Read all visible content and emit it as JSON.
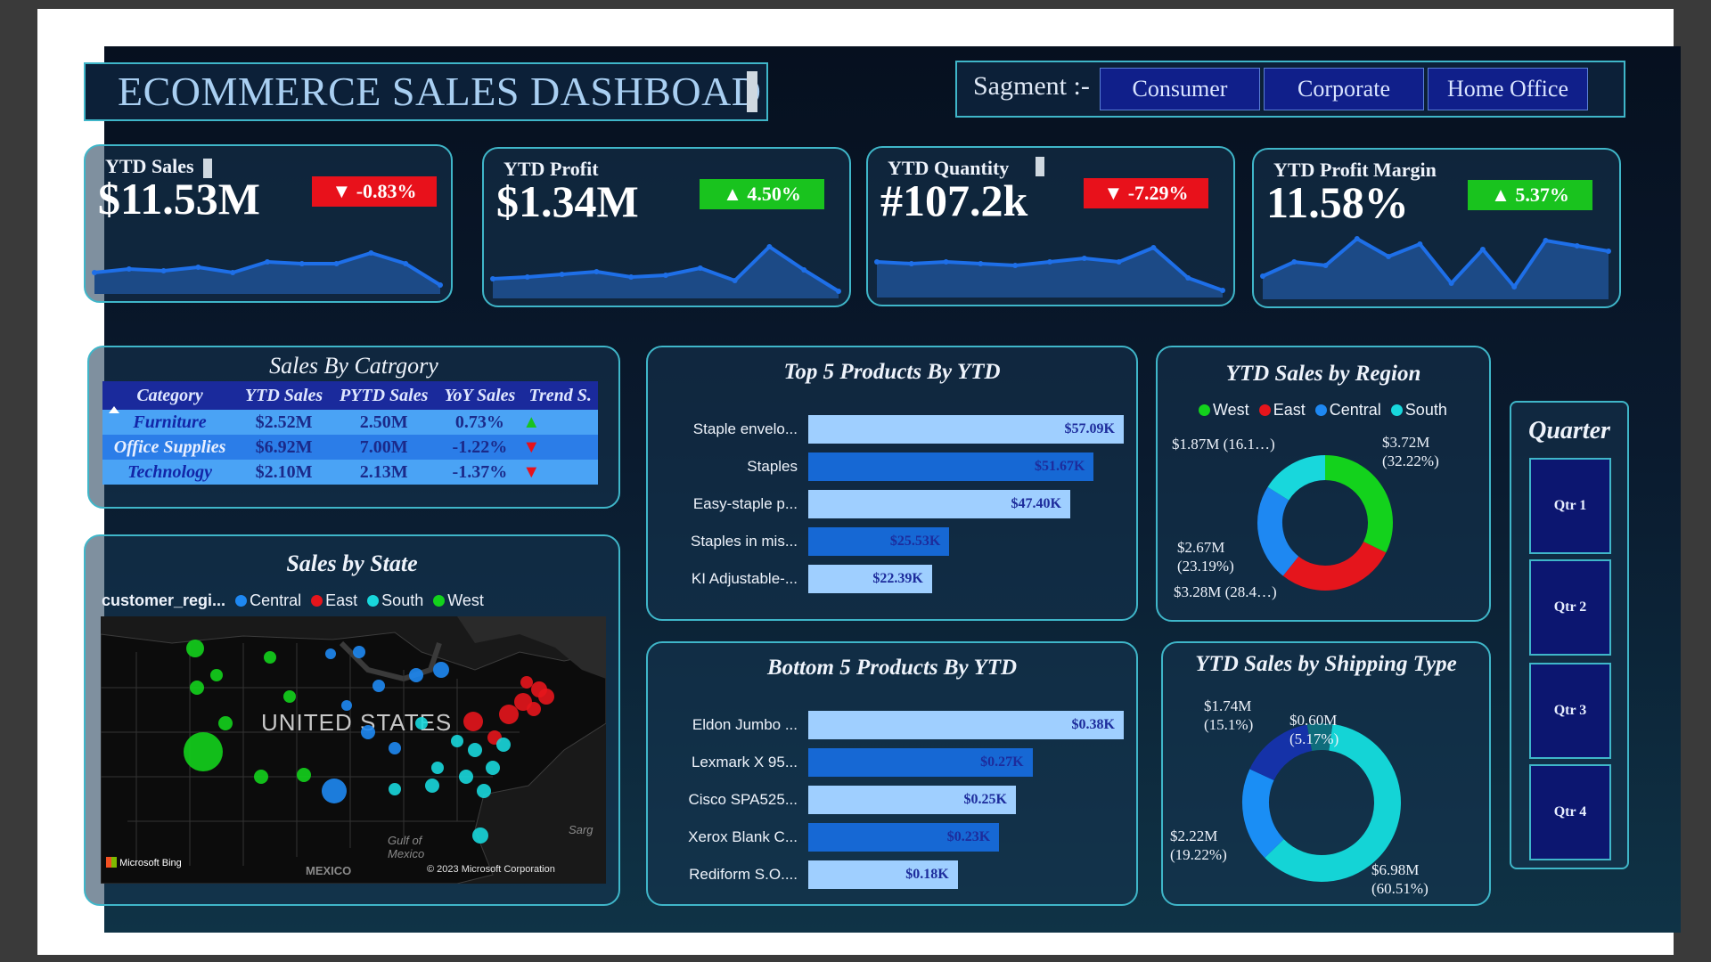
{
  "header": {
    "title": "ECOMMERCE SALES DASHBOAD"
  },
  "segment": {
    "label": "Sagment :-",
    "options": [
      "Consumer",
      "Corporate",
      "Home Office"
    ]
  },
  "kpis": [
    {
      "name": "YTD Sales",
      "value": "$11.53M",
      "change": "▼ -0.83%",
      "direction": "down",
      "trend": [
        24,
        28,
        26,
        30,
        24,
        36,
        34,
        34,
        46,
        34,
        10
      ]
    },
    {
      "name": "YTD Profit",
      "value": "$1.34M",
      "change": "▲ 4.50%",
      "direction": "up",
      "trend": [
        22,
        24,
        27,
        30,
        24,
        26,
        34,
        20,
        58,
        32,
        8
      ]
    },
    {
      "name": "YTD Quantity",
      "value": "#107.2k",
      "change": "▼ -7.29%",
      "direction": "down",
      "trend": [
        40,
        38,
        40,
        38,
        36,
        40,
        44,
        40,
        56,
        22,
        8
      ]
    },
    {
      "name": "YTD Profit Margin",
      "value": "11.58%",
      "change": "▲ 5.37%",
      "direction": "up",
      "trend": [
        26,
        42,
        38,
        68,
        48,
        62,
        18,
        56,
        14,
        66,
        60,
        54
      ]
    }
  ],
  "colors": {
    "up": "#19c31e",
    "down": "#e8111b",
    "bar_light": "#9fcfff",
    "bar_dark": "#1668d4",
    "west": "#13d21c",
    "east": "#e5151c",
    "central": "#1e88f2",
    "south": "#18d7dc"
  },
  "category_table": {
    "title": "Sales By Catrgory",
    "headers": [
      "Category",
      "YTD Sales",
      "PYTD Sales",
      "YoY Sales",
      "Trend S."
    ],
    "rows": [
      {
        "category": "Furniture",
        "ytd": "$2.52M",
        "pytd": "2.50M",
        "yoy": "0.73%",
        "trend": "▲",
        "trend_dir": "up"
      },
      {
        "category": "Office Supplies",
        "ytd": "$6.92M",
        "pytd": "7.00M",
        "yoy": "-1.22%",
        "trend": "▼",
        "trend_dir": "down"
      },
      {
        "category": "Technology",
        "ytd": "$2.10M",
        "pytd": "2.13M",
        "yoy": "-1.37%",
        "trend": "▼",
        "trend_dir": "down"
      }
    ]
  },
  "top_products": {
    "title": "Top 5 Products By YTD",
    "items": [
      {
        "label": "Staple envelo...",
        "value_label": "$57.09K",
        "value": 57.09
      },
      {
        "label": "Staples",
        "value_label": "$51.67K",
        "value": 51.67
      },
      {
        "label": "Easy-staple p...",
        "value_label": "$47.40K",
        "value": 47.4
      },
      {
        "label": "Staples in mis...",
        "value_label": "$25.53K",
        "value": 25.53
      },
      {
        "label": "KI Adjustable-...",
        "value_label": "$22.39K",
        "value": 22.39
      }
    ]
  },
  "bottom_products": {
    "title": "Bottom 5 Products By YTD",
    "items": [
      {
        "label": "Eldon Jumbo ...",
        "value_label": "$0.38K",
        "value": 0.38
      },
      {
        "label": "Lexmark X 95...",
        "value_label": "$0.27K",
        "value": 0.27
      },
      {
        "label": "Cisco SPA525...",
        "value_label": "$0.25K",
        "value": 0.25
      },
      {
        "label": "Xerox Blank C...",
        "value_label": "$0.23K",
        "value": 0.23
      },
      {
        "label": "Rediform S.O....",
        "value_label": "$0.18K",
        "value": 0.18
      }
    ]
  },
  "region_chart": {
    "title": "YTD Sales by Region",
    "legend": [
      "West",
      "East",
      "Central",
      "South"
    ],
    "labels": {
      "west": [
        "$3.72M",
        "(32.22%)"
      ],
      "east": [
        "$3.28M (28.4…)"
      ],
      "central": [
        "$2.67M",
        "(23.19%)"
      ],
      "south": [
        "$1.87M (16.1…)"
      ]
    },
    "shares": [
      32.22,
      28.4,
      23.19,
      16.1
    ]
  },
  "shipping_chart": {
    "title": "YTD Sales by Shipping Type",
    "labels": {
      "a": [
        "$6.98M",
        "(60.51%)"
      ],
      "b": [
        "$2.22M",
        "(19.22%)"
      ],
      "c": [
        "$1.74M",
        "(15.1%)"
      ],
      "d": [
        "$0.60M",
        "(5.17%)"
      ]
    },
    "shares": [
      60.51,
      19.22,
      15.1,
      5.17
    ]
  },
  "map": {
    "title": "Sales by State",
    "legend_field": "customer_regi...",
    "legend": [
      "Central",
      "East",
      "South",
      "West"
    ],
    "country_label": "UNITED STATES",
    "gulf_label_1": "Gulf of",
    "gulf_label_2": "Mexico",
    "mexico_label": "MEXICO",
    "sarg_label": "Sarg",
    "bing_label": "Microsoft Bing",
    "copyright": "© 2023 Microsoft Corporation"
  },
  "quarter": {
    "title": "Quarter",
    "options": [
      "Qtr 1",
      "Qtr 2",
      "Qtr 3",
      "Qtr 4"
    ]
  }
}
